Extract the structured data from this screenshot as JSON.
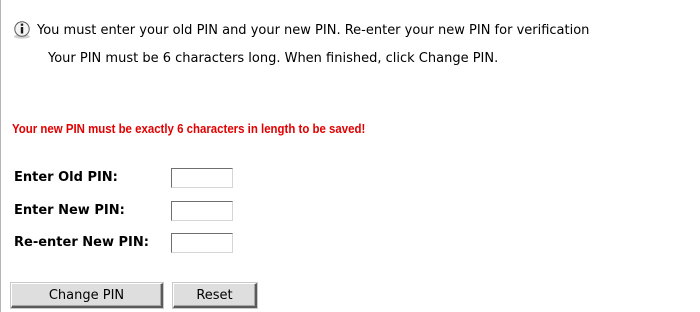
{
  "info": {
    "icon": "info-icon",
    "message": "You must enter your old PIN and your new PIN. Re-enter your new PIN for verification",
    "instructions": "Your PIN must be 6 characters long. When finished, click Change PIN."
  },
  "warning": {
    "text": "Your new PIN must be exactly 6 characters in length to be saved!",
    "color": "#e30000"
  },
  "form": {
    "old_pin_label": "Enter Old PIN:",
    "old_pin_value": "",
    "new_pin_label": "Enter New PIN:",
    "new_pin_value": "",
    "reenter_pin_label": "Re-enter New PIN:",
    "reenter_pin_value": ""
  },
  "buttons": {
    "change_pin_label": "Change PIN",
    "reset_label": "Reset"
  }
}
